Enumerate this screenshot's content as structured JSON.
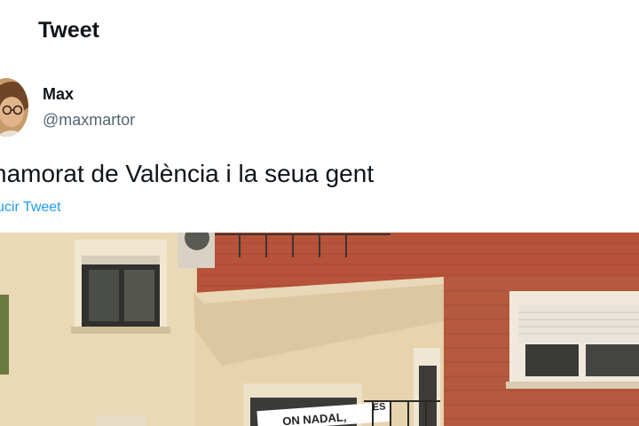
{
  "header": {
    "title": "Tweet"
  },
  "tweet": {
    "author": {
      "name": "Max",
      "handle": "@maxmartor"
    },
    "text": "namorat de València i la seua gent",
    "translate_label": "ucir Tweet",
    "media": {
      "banner_text": "ON NADAL,",
      "banner_text_2": "ES"
    }
  },
  "colors": {
    "link": "#1d9bf0",
    "secondary": "#536471",
    "primary": "#0f1419"
  }
}
